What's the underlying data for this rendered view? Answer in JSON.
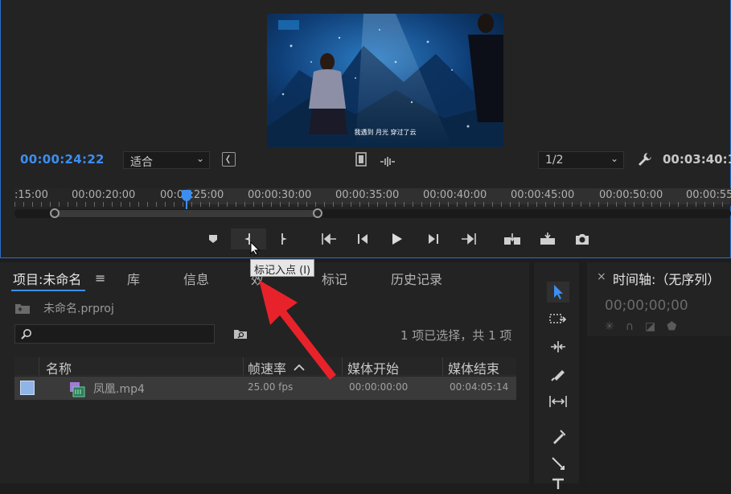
{
  "monitor": {
    "timecode_current": "00:00:24:22",
    "fit_select": "适合",
    "resolution_select": "1/2",
    "timecode_duration": "00:03:40:1",
    "ruler_labels": [
      ":15:00",
      "00:00:20:00",
      "00:00:25:00",
      "00:00:30:00",
      "00:00:35:00",
      "00:00:40:00",
      "00:00:45:00",
      "00:00:50:00",
      "00:00:55"
    ],
    "tooltip": "标记入点 (I)",
    "video_caption": "我遇到 月光 穿过了云",
    "accent": "#3d8ef0"
  },
  "transport": {
    "icons": [
      "add-marker-icon",
      "mark-in-icon",
      "mark-out-icon",
      "go-to-in-icon",
      "step-back-icon",
      "play-icon",
      "step-forward-icon",
      "go-to-out-icon",
      "insert-icon",
      "overwrite-icon",
      "export-frame-icon"
    ]
  },
  "project": {
    "tabs": {
      "project": "项目:未命名",
      "library": "库",
      "info": "信息",
      "effects": "效",
      "markers": "标记",
      "history": "历史记录"
    },
    "file_name": "未命名.prproj",
    "selection_info": "1 项已选择，共 1 项",
    "columns": {
      "name": "名称",
      "framerate": "帧速率",
      "media_start": "媒体开始",
      "media_end": "媒体结束"
    },
    "rows": [
      {
        "name": "凤凰.mp4",
        "framerate": "25.00 fps",
        "media_start": "00:00:00:00",
        "media_end": "00:04:05:14"
      }
    ]
  },
  "timeline": {
    "title": "时间轴:（无序列）",
    "timecode": "00;00;00;00"
  },
  "annotation": {
    "arrow_color": "#e8222a"
  }
}
